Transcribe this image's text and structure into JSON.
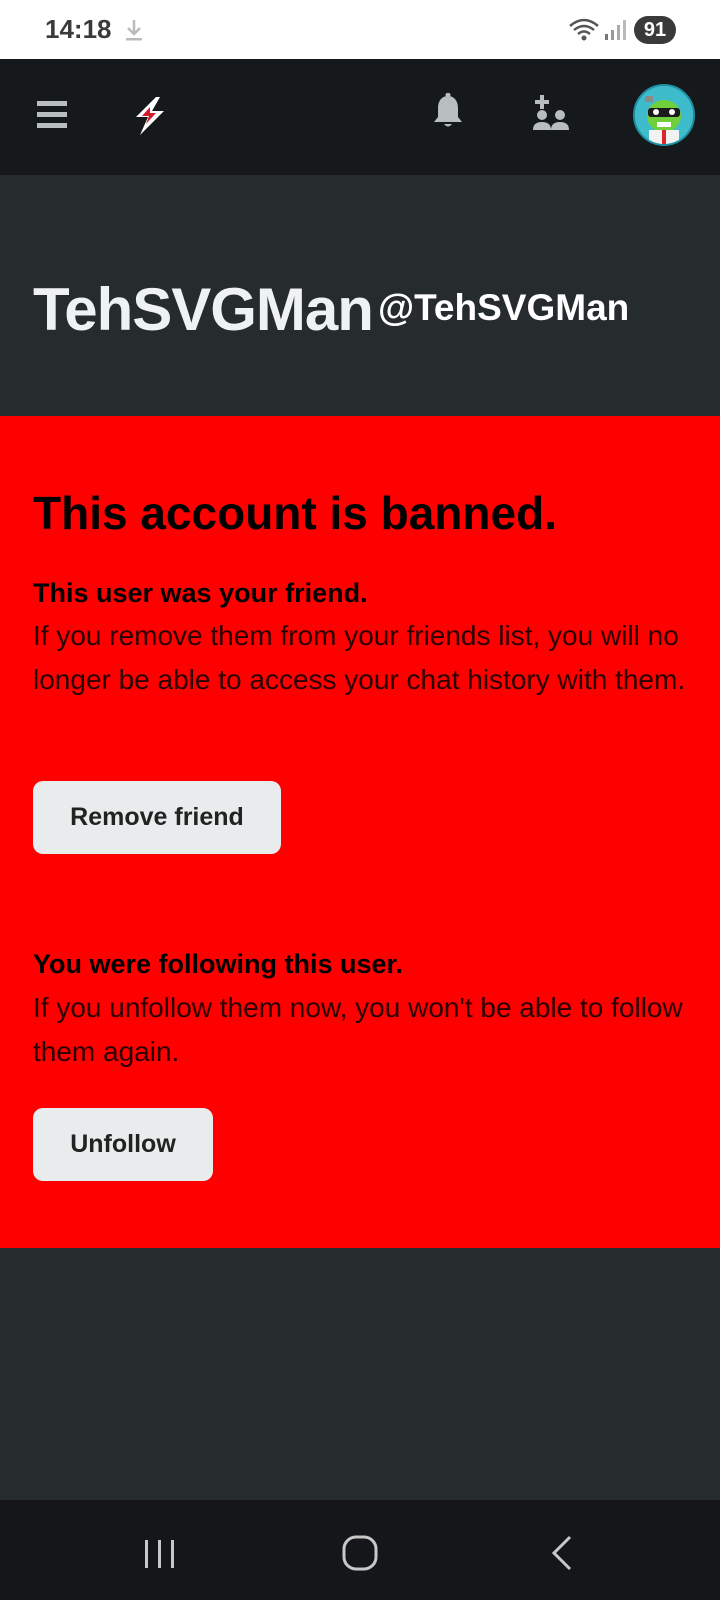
{
  "status_bar": {
    "time": "14:18",
    "battery": "91",
    "icons": [
      "download-icon",
      "wifi-icon",
      "signal-icon"
    ]
  },
  "app_bar": {
    "icons": [
      "menu-icon",
      "app-logo-icon",
      "bell-icon",
      "add-friend-icon",
      "avatar"
    ]
  },
  "profile": {
    "display_name": "TehSVGMan",
    "username": "@TehSVGMan"
  },
  "ban_panel": {
    "title": "This account is banned.",
    "friend_section": {
      "title": "This user was your friend.",
      "text": "If you remove them from your friends list, you will no longer be able to access your chat history with them.",
      "button_label": "Remove friend"
    },
    "follow_section": {
      "title": "You were following this user.",
      "text": "If you unfollow them now, you won't be able to follow them again.",
      "button_label": "Unfollow"
    }
  },
  "nav_bar": {
    "icons": [
      "recents-icon",
      "home-icon",
      "back-icon"
    ]
  },
  "colors": {
    "ban_background": "#ff0000",
    "app_bar": "#15191b",
    "page_background": "#262b2d",
    "button_background": "#e8ecec"
  }
}
